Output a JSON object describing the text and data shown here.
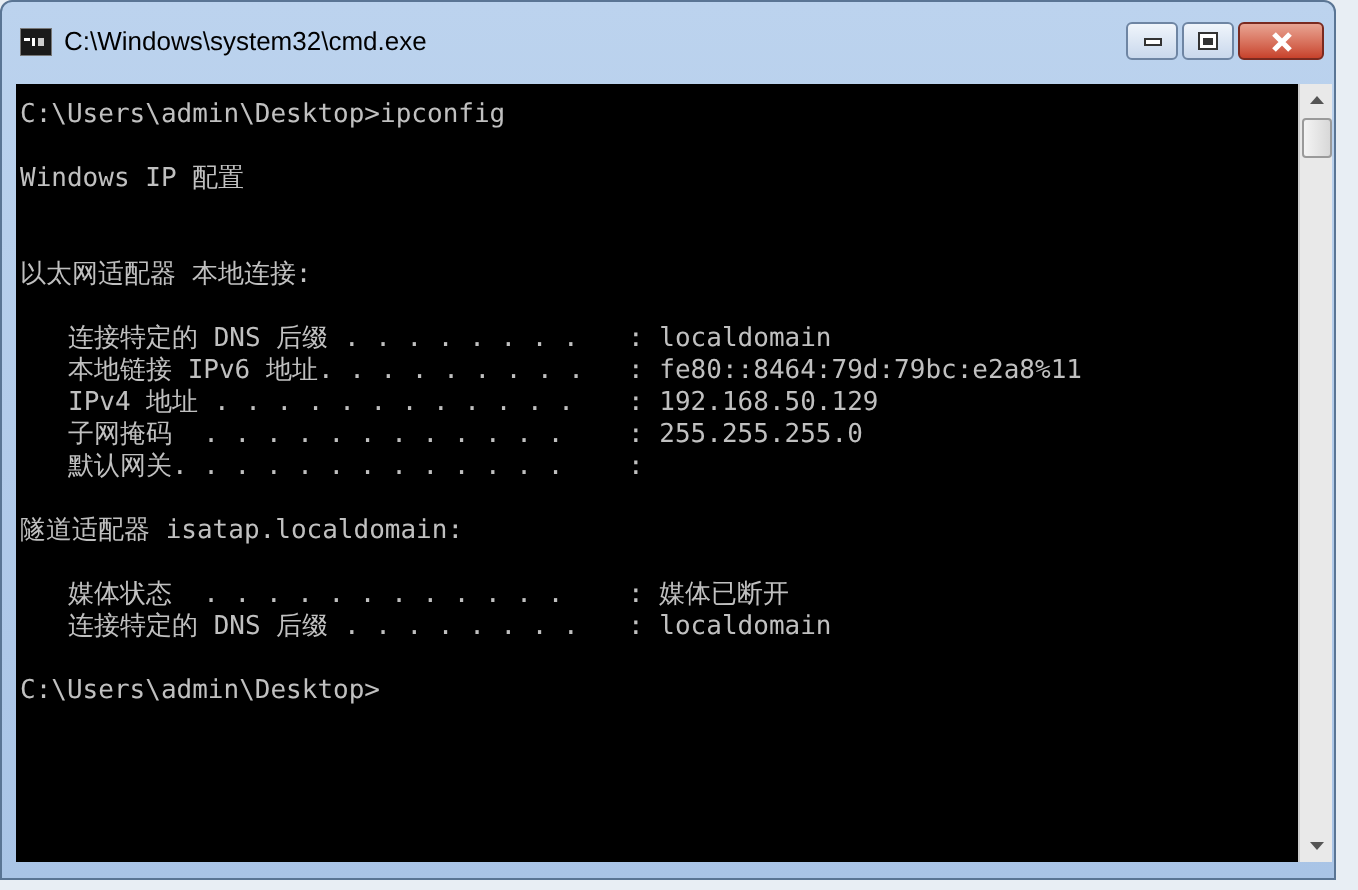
{
  "window": {
    "title": "C:\\Windows\\system32\\cmd.exe"
  },
  "console": {
    "lines": [
      {
        "kind": "command",
        "text": "C:\\Users\\admin\\Desktop>ipconfig"
      },
      {
        "kind": "title",
        "text": "Windows IP 配置"
      },
      {
        "kind": "adapter",
        "text": "以太网适配器 本地连接:"
      },
      {
        "kind": "entry",
        "label": "连接特定的 DNS 后缀 . . . . . . . .",
        "value": ": localdomain"
      },
      {
        "kind": "entry",
        "label": "本地链接 IPv6 地址. . . . . . . . .",
        "value": ": fe80::8464:79d:79bc:e2a8%11"
      },
      {
        "kind": "entry",
        "label": "IPv4 地址 . . . . . . . . . . . .",
        "value": ": 192.168.50.129"
      },
      {
        "kind": "entry",
        "label": "子网掩码  . . . . . . . . . . . .",
        "value": ": 255.255.255.0"
      },
      {
        "kind": "entry",
        "label": "默认网关. . . . . . . . . . . . .",
        "value": ":"
      },
      {
        "kind": "adapter",
        "text": "隧道适配器 isatap.localdomain:"
      },
      {
        "kind": "entry",
        "label": "媒体状态  . . . . . . . . . . . .",
        "value": ": 媒体已断开"
      },
      {
        "kind": "entry",
        "label": "连接特定的 DNS 后缀 . . . . . . . .",
        "value": ": localdomain"
      },
      {
        "kind": "command",
        "text": "C:\\Users\\admin\\Desktop>"
      }
    ]
  }
}
